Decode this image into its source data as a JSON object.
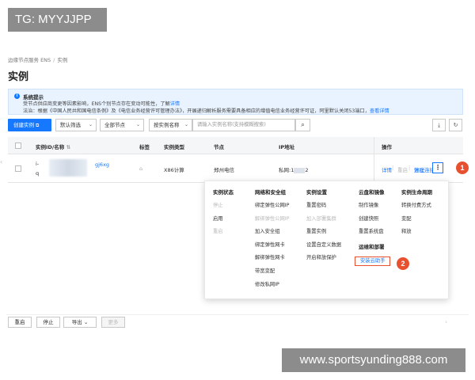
{
  "overlay_tag": "TG: MYYJJPP",
  "watermark": "www.sportsyunding888.com",
  "breadcrumb": [
    "边缘节点服务 ENS",
    "实例"
  ],
  "page_title": "实例",
  "notice": {
    "title": "系统提示",
    "line1": "受节点供应商变更等因素影响，ENS个别节点存在变动可能性，了解",
    "line1_link": "详情",
    "line2": "法治：根据《中国人民共和国电信条例》及《电信业务经营许可管理办法》，开展递归解析服务需要具备相应的增值电信业务经营许可证，阿里默认关闭53端口，",
    "line2_link": "查看详情"
  },
  "toolbar": {
    "create_label": "创建实例",
    "create_icon": "external-link-icon",
    "filter_label": "默认筛选",
    "node_label": "全部节点",
    "search_field_label": "按实例名称",
    "search_placeholder": "请输入实例名称(支持模糊搜索)",
    "search_icon": "search-icon",
    "download_icon": "download-icon",
    "refresh_icon": "refresh-icon"
  },
  "table": {
    "headers": {
      "id": "实例ID/名称",
      "id_sort_icon": "sort-icon",
      "tag": "标签",
      "type": "实例类型",
      "node": "节点",
      "ip": "IP地址",
      "ops": "操作"
    },
    "row": {
      "id_prefix": "i-",
      "name_prefix": "q",
      "id_suffix": "gj6xg",
      "tag_icon": "tag-icon",
      "type": "X86计算",
      "node": "郑州电信",
      "ip_prefix": "私网:1",
      "ip_suffix": "2",
      "op_detail": "详情",
      "op_restart": "重启",
      "op_stop": "停止",
      "op_remote": "远程连接",
      "more_icon": "more-vertical-icon"
    }
  },
  "markers": [
    "1",
    "2"
  ],
  "menu": {
    "columns": [
      {
        "title": "实例状态",
        "items": [
          {
            "label": "停止",
            "disabled": true
          },
          {
            "label": "启用",
            "disabled": false
          },
          {
            "label": "重启",
            "disabled": true
          }
        ]
      },
      {
        "title": "网络和安全组",
        "items": [
          {
            "label": "绑定弹性公网IP",
            "disabled": false
          },
          {
            "label": "解绑弹性公网IP",
            "disabled": true
          },
          {
            "label": "加入安全组",
            "disabled": false
          },
          {
            "label": "绑定弹性网卡",
            "disabled": false
          },
          {
            "label": "解绑弹性网卡",
            "disabled": false
          },
          {
            "label": "带宽变配",
            "disabled": false
          },
          {
            "label": "修改私网IP",
            "disabled": false
          }
        ]
      },
      {
        "title": "实例设置",
        "items": [
          {
            "label": "重置密码",
            "disabled": false
          },
          {
            "label": "加入部署集群",
            "disabled": true
          },
          {
            "label": "重置实例",
            "disabled": false
          },
          {
            "label": "设置自定义数据",
            "disabled": false
          },
          {
            "label": "开启释放保护",
            "disabled": false
          }
        ]
      },
      {
        "title": "云盘和镜像",
        "items": [
          {
            "label": "制作镜像",
            "disabled": false
          },
          {
            "label": "创建快照",
            "disabled": false
          },
          {
            "label": "重置系统盘",
            "disabled": false
          }
        ]
      },
      {
        "title": "实例生命周期",
        "items": [
          {
            "label": "转换付费方式",
            "disabled": false
          },
          {
            "label": "变配",
            "disabled": false
          },
          {
            "label": "释放",
            "disabled": false
          }
        ]
      }
    ],
    "ops_section": {
      "title": "运维和部署",
      "item": "安装云助手"
    }
  },
  "bottom": {
    "restart": "重启",
    "stop": "停止",
    "export": "导出",
    "more": "更多",
    "next_icon": "chevron-right-icon"
  }
}
